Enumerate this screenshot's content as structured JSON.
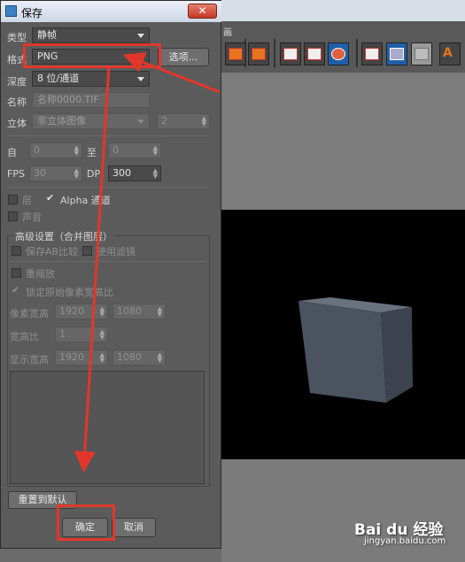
{
  "background_app": {
    "view_label": "画",
    "viewport_cube_color": "#565f6c"
  },
  "dialog": {
    "title": "保存",
    "close_glyph": "✕",
    "type": {
      "label": "类型",
      "value": "静帧"
    },
    "format": {
      "label": "格式",
      "value": "PNG",
      "options_button": "选项..."
    },
    "depth": {
      "label": "深度",
      "value": "8 位/通道"
    },
    "name": {
      "label": "名称",
      "value": "名称0000.TIF"
    },
    "stereo": {
      "label": "立体",
      "value": "非立体图像",
      "count": "2"
    },
    "range": {
      "from_label": "自",
      "from_value": "0",
      "to_label": "至",
      "to_value": "0"
    },
    "fps": {
      "label": "FPS",
      "value": "30"
    },
    "dpi": {
      "label": "DPI",
      "value": "300"
    },
    "layers_label": "层",
    "alpha_label": "Alpha 通道",
    "sound_label": "声音",
    "advanced": {
      "title": "高级设置（合并图层）",
      "save_ab_label": "保存AB比较",
      "use_filter_label": "使用滤镜",
      "rescale_label": "重缩放",
      "lock_ratio_label": "锁定原始像素宽高比",
      "pixel_size": {
        "label": "像素宽高",
        "w": "1920",
        "h": "1080"
      },
      "aspect": {
        "label": "宽高比",
        "value": "1"
      },
      "display_size": {
        "label": "显示宽高",
        "w": "1920",
        "h": "1080"
      }
    },
    "reset_button": "重置到默认",
    "ok_button": "确定",
    "cancel_button": "取消"
  },
  "annotation": {
    "color": "#e2362b"
  },
  "watermark": {
    "brand": "Bai du 经验",
    "url": "jingyan.baidu.com"
  }
}
